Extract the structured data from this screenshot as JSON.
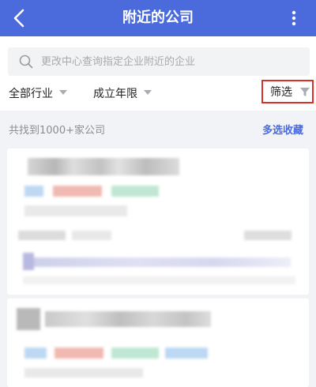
{
  "header": {
    "title": "附近的公司",
    "back_icon": "chevron-left-icon",
    "more_icon": "more-vertical-icon",
    "color": "#4b6bdc"
  },
  "search": {
    "placeholder": "更改中心查询指定企业附近的企业",
    "value": ""
  },
  "filters": {
    "industry": "全部行业",
    "founded": "成立年限",
    "screen": "筛选"
  },
  "results": {
    "count_text": "共找到1000+家公司",
    "multi_select": "多选收藏"
  },
  "highlight_color": "#d8312a"
}
